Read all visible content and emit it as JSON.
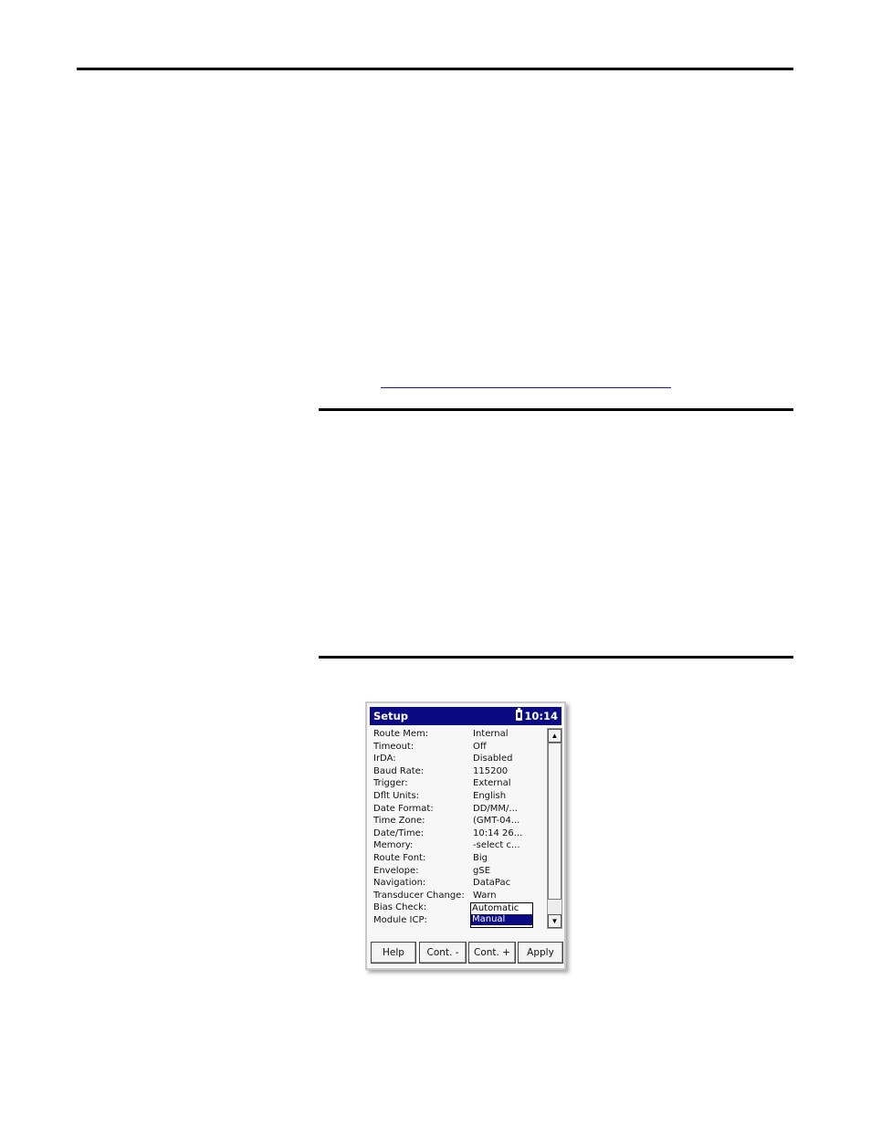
{
  "titlebar": {
    "title": "Setup",
    "time": "10:14",
    "battery_icon": "battery-icon"
  },
  "settings": [
    {
      "label": "Route Mem:",
      "value": "Internal"
    },
    {
      "label": "Timeout:",
      "value": "Off"
    },
    {
      "label": "IrDA:",
      "value": "Disabled"
    },
    {
      "label": "Baud Rate:",
      "value": "115200"
    },
    {
      "label": "Trigger:",
      "value": "External"
    },
    {
      "label": "Dflt Units:",
      "value": "English"
    },
    {
      "label": "Date Format:",
      "value": "DD/MM/..."
    },
    {
      "label": "Time Zone:",
      "value": "(GMT-04..."
    },
    {
      "label": "Date/Time:",
      "value": "10:14 26..."
    },
    {
      "label": "Memory:",
      "value": "-select c..."
    },
    {
      "label": "Route Font:",
      "value": "Big"
    },
    {
      "label": "Envelope:",
      "value": "gSE"
    },
    {
      "label": "Navigation:",
      "value": "DataPac"
    },
    {
      "label": "Transducer Change:",
      "value": "Warn"
    },
    {
      "label": "Bias Check:",
      "value": ""
    },
    {
      "label": "Module ICP:",
      "value": ""
    }
  ],
  "dropdown": {
    "options": [
      "Automatic",
      "Manual"
    ],
    "selected": "Manual"
  },
  "buttons": {
    "help": "Help",
    "cont_minus": "Cont. -",
    "cont_plus": "Cont. +",
    "apply": "Apply"
  }
}
